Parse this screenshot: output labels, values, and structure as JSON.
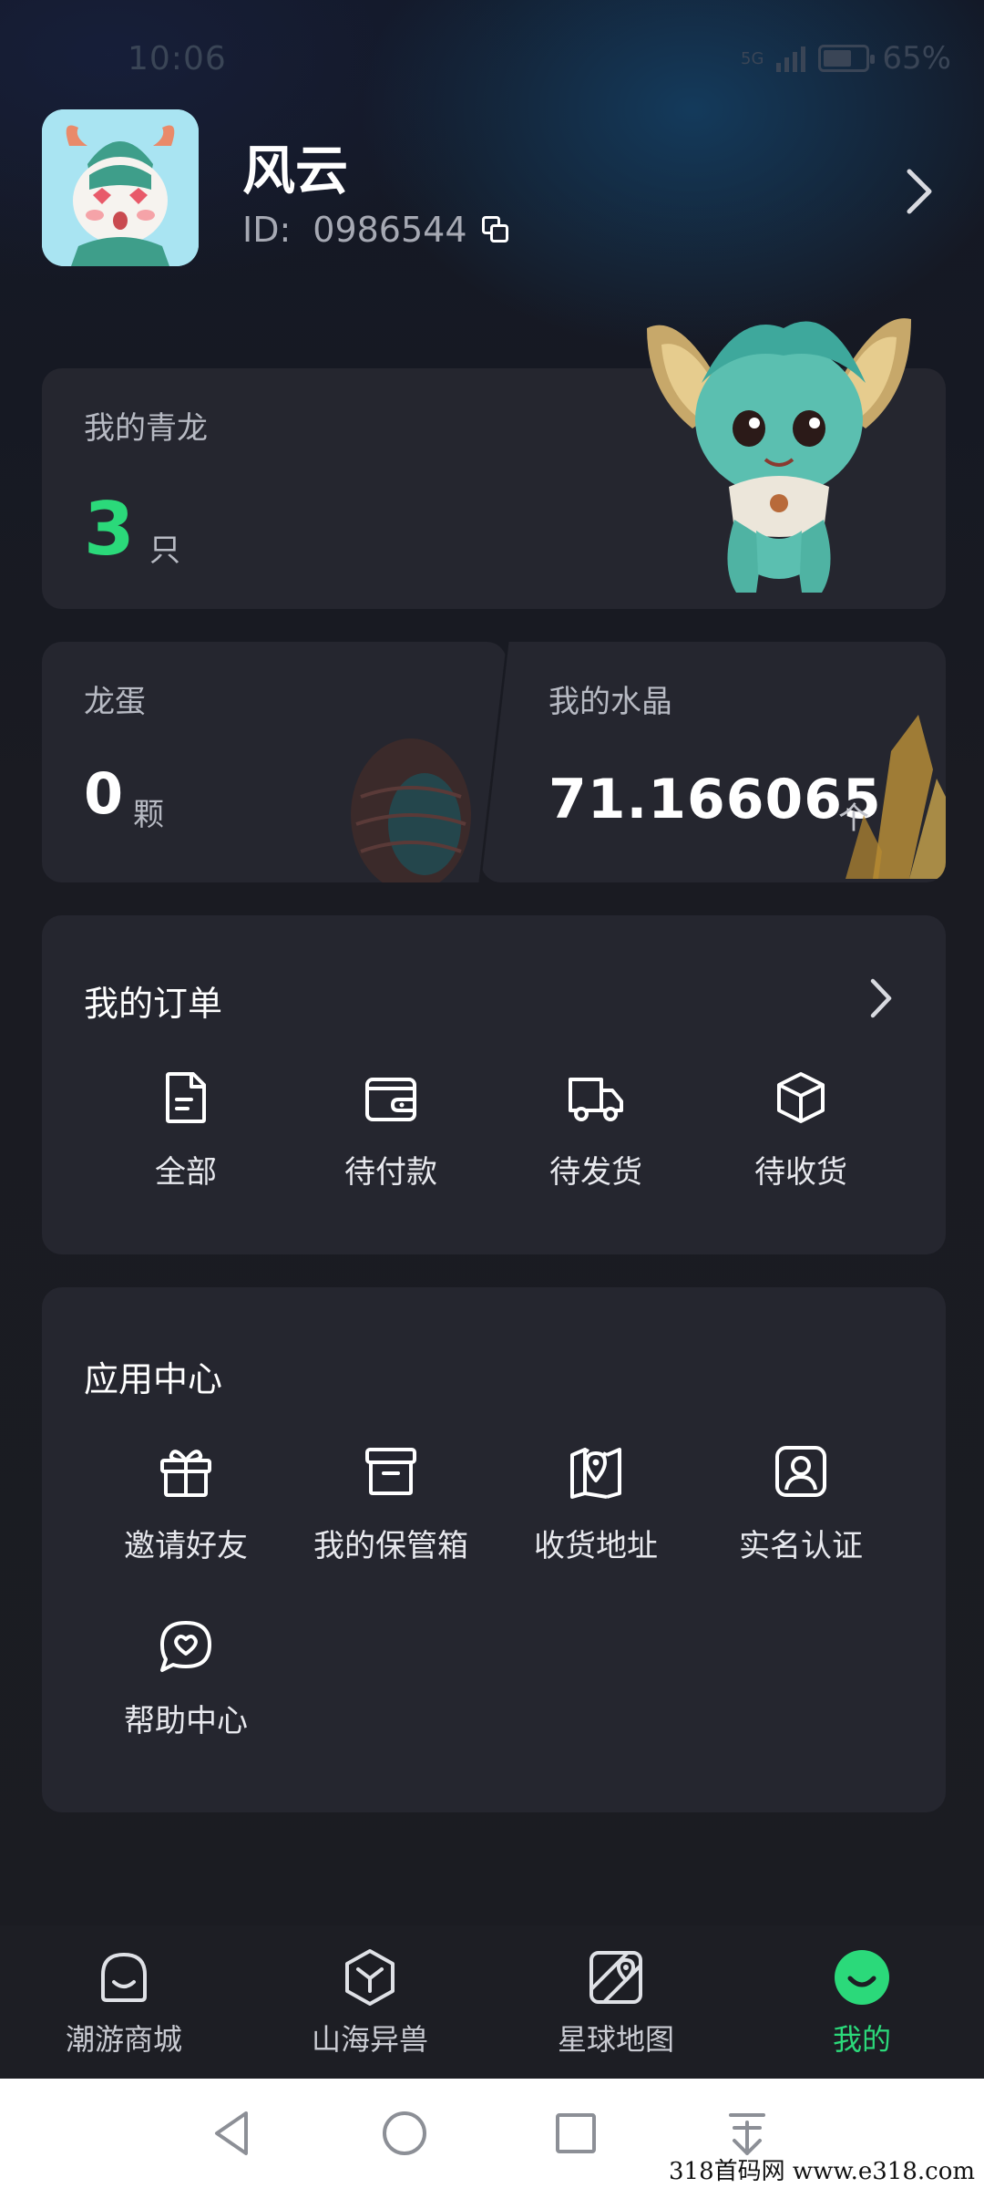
{
  "status_bar": {
    "time": "10:06",
    "network": "5G",
    "battery": "65%"
  },
  "profile": {
    "name": "风云",
    "id_label": "ID:",
    "id_value": "0986544"
  },
  "qinglong": {
    "label": "我的青龙",
    "count": "3",
    "unit": "只"
  },
  "egg": {
    "label": "龙蛋",
    "count": "0",
    "unit": "颗"
  },
  "crystal": {
    "label": "我的水晶",
    "value": "71.166065",
    "trend": "个"
  },
  "orders": {
    "title": "我的订单",
    "items": [
      {
        "label": "全部",
        "icon": "document-icon"
      },
      {
        "label": "待付款",
        "icon": "wallet-icon"
      },
      {
        "label": "待发货",
        "icon": "truck-icon"
      },
      {
        "label": "待收货",
        "icon": "box-icon"
      }
    ]
  },
  "apps": {
    "title": "应用中心",
    "items": [
      {
        "label": "邀请好友",
        "icon": "gift-icon"
      },
      {
        "label": "我的保管箱",
        "icon": "archive-icon"
      },
      {
        "label": "收货地址",
        "icon": "map-pin-icon"
      },
      {
        "label": "实名认证",
        "icon": "user-badge-icon"
      },
      {
        "label": "帮助中心",
        "icon": "chat-heart-icon"
      }
    ]
  },
  "bottom_nav": {
    "items": [
      {
        "label": "潮游商城",
        "icon": "shop-bag-icon"
      },
      {
        "label": "山海异兽",
        "icon": "cube-icon"
      },
      {
        "label": "星球地图",
        "icon": "map-icon"
      },
      {
        "label": "我的",
        "icon": "smile-icon",
        "active": true
      }
    ],
    "active_color": "#2bd97a"
  },
  "watermark": "318首码网 www.e318.com",
  "colors": {
    "accent": "#2bd97a",
    "card": "#25262f",
    "background": "#1b1c22"
  }
}
